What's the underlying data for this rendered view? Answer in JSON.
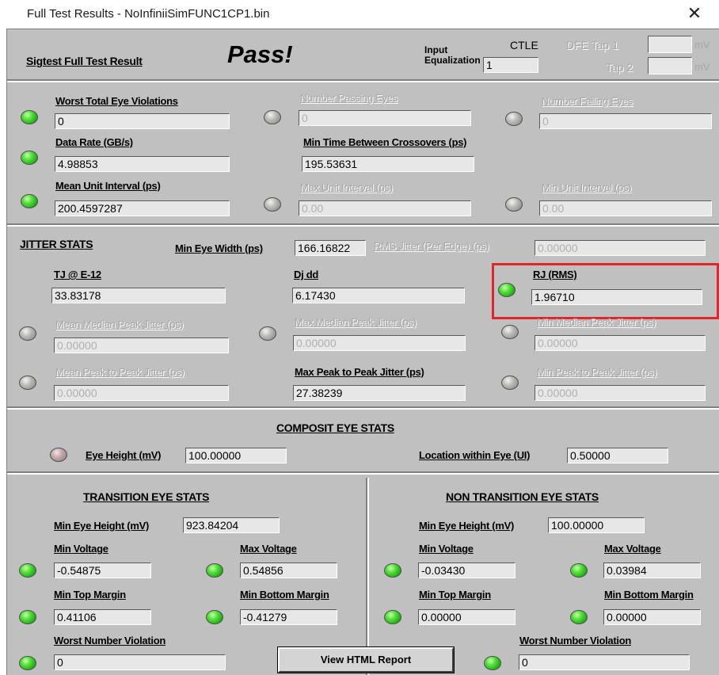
{
  "window": {
    "title": "Full Test Results - NoInfiniiSimFUNC1CP1.bin",
    "close": "✕"
  },
  "header": {
    "label": "Sigtest Full Test Result",
    "result": "Pass!",
    "input_eq_label": "Input Equalization",
    "input_eq_value": "1",
    "ctle": "CTLE",
    "dfe_tap1": "DFE Tap 1",
    "tap2": "Tap 2",
    "unit1": "mV",
    "unit2": "mV"
  },
  "eye_summary": {
    "worst_total_eye_violations": {
      "label": "Worst Total Eye Violations",
      "value": "0"
    },
    "number_passing_eyes": {
      "label": "Number Passing Eyes",
      "value": "0"
    },
    "number_failing_eyes": {
      "label": "Number Failing Eyes",
      "value": "0"
    },
    "data_rate": {
      "label": "Data Rate (GB/s)",
      "value": "4.98853"
    },
    "min_time_between_crossovers": {
      "label": "Min Time Between Crossovers (ps)",
      "value": "195.53631"
    },
    "mean_unit_interval": {
      "label": "Mean Unit Interval (ps)",
      "value": "200.4597287"
    },
    "max_unit_interval": {
      "label": "Max Unit Interval (ps)",
      "value": "0.00"
    },
    "min_unit_interval": {
      "label": "Min Unit Interval (ps)",
      "value": "0.00"
    }
  },
  "jitter": {
    "title": "JITTER STATS",
    "min_eye_width": {
      "label": "Min Eye Width (ps)",
      "value": "166.16822"
    },
    "rms_jitter": {
      "label": "RMS Jitter (Per Edge) (ps)",
      "value": "0.00000"
    },
    "tj": {
      "label": "TJ @ E-12",
      "value": "33.83178"
    },
    "dj": {
      "label": "Dj dd",
      "value": "6.17430"
    },
    "rj": {
      "label": "RJ (RMS)",
      "value": "1.96710"
    },
    "mean_median_peak": {
      "label": "Mean Median Peak Jitter (ps)",
      "value": "0.00000"
    },
    "max_median_peak": {
      "label": "Max Median Peak Jitter (ps)",
      "value": "0.00000"
    },
    "min_median_peak": {
      "label": "Min Median Peak Jitter (ps)",
      "value": "0.00000"
    },
    "mean_p2p": {
      "label": "Mean Peak to Peak Jitter (ps)",
      "value": "0.00000"
    },
    "max_p2p": {
      "label": "Max Peak to Peak Jitter (ps)",
      "value": "27.38239"
    },
    "min_p2p": {
      "label": "Min Peak to Peak Jitter (ps)",
      "value": "0.00000"
    }
  },
  "composite": {
    "title": "COMPOSIT EYE STATS",
    "eye_height": {
      "label": "Eye Height (mV)",
      "value": "100.00000"
    },
    "location": {
      "label": "Location within Eye (UI)",
      "value": "0.50000"
    }
  },
  "transition": {
    "title": "TRANSITION EYE STATS",
    "min_eye_height": {
      "label": "Min Eye Height (mV)",
      "value": "923.84204"
    },
    "min_voltage": {
      "label": "Min Voltage",
      "value": "-0.54875"
    },
    "max_voltage": {
      "label": "Max Voltage",
      "value": "0.54856"
    },
    "min_top_margin": {
      "label": "Min Top Margin",
      "value": "0.41106"
    },
    "min_bottom_margin": {
      "label": "Min Bottom Margin",
      "value": "-0.41279"
    },
    "worst_number_violation": {
      "label": "Worst Number Violation",
      "value": "0"
    }
  },
  "non_transition": {
    "title": "NON TRANSITION EYE STATS",
    "min_eye_height": {
      "label": "Min Eye Height (mV)",
      "value": "100.00000"
    },
    "min_voltage": {
      "label": "Min Voltage",
      "value": "-0.03430"
    },
    "max_voltage": {
      "label": "Max Voltage",
      "value": "0.03984"
    },
    "min_top_margin": {
      "label": "Min Top Margin",
      "value": "0.00000"
    },
    "min_bottom_margin": {
      "label": "Min Bottom Margin",
      "value": "0.00000"
    },
    "worst_number_violation": {
      "label": "Worst Number Violation",
      "value": "0"
    }
  },
  "view_html_button": "View HTML Report",
  "colors": {
    "panel": "#c0c0c0",
    "led_green": "#2fcf1c",
    "highlight": "#e2242b"
  }
}
